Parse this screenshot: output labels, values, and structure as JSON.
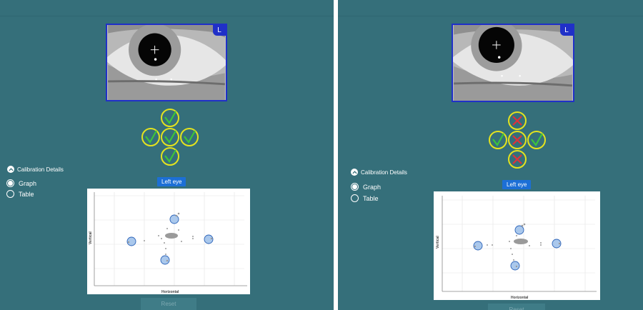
{
  "panels": [
    {
      "eye_badge": "L",
      "calibration_points": {
        "top": "pass",
        "left": "pass",
        "center": "pass",
        "right": "pass",
        "bottom": "pass"
      },
      "details_label": "Calibration Details",
      "view_options": [
        {
          "label": "Graph",
          "selected": true
        },
        {
          "label": "Table",
          "selected": false
        }
      ],
      "eye_label": "Left eye",
      "graph": {
        "xlabel": "Horizontal",
        "ylabel": "Vertical"
      },
      "reset_label": "Reset"
    },
    {
      "eye_badge": "L",
      "calibration_points": {
        "top": "fail",
        "left": "pass",
        "center": "fail",
        "right": "pass",
        "bottom": "fail"
      },
      "details_label": "Calibration Details",
      "view_options": [
        {
          "label": "Graph",
          "selected": true
        },
        {
          "label": "Table",
          "selected": false
        }
      ],
      "eye_label": "Left eye",
      "graph": {
        "xlabel": "Horizontal",
        "ylabel": "Vertical"
      },
      "reset_label": "Reset"
    }
  ],
  "colors": {
    "background": "#356f7a",
    "frame": "#2030c8",
    "ring": "#e4e31e",
    "pass": "#3cc43c",
    "fail": "#e0303a",
    "label_bg": "#1c6fd6"
  }
}
